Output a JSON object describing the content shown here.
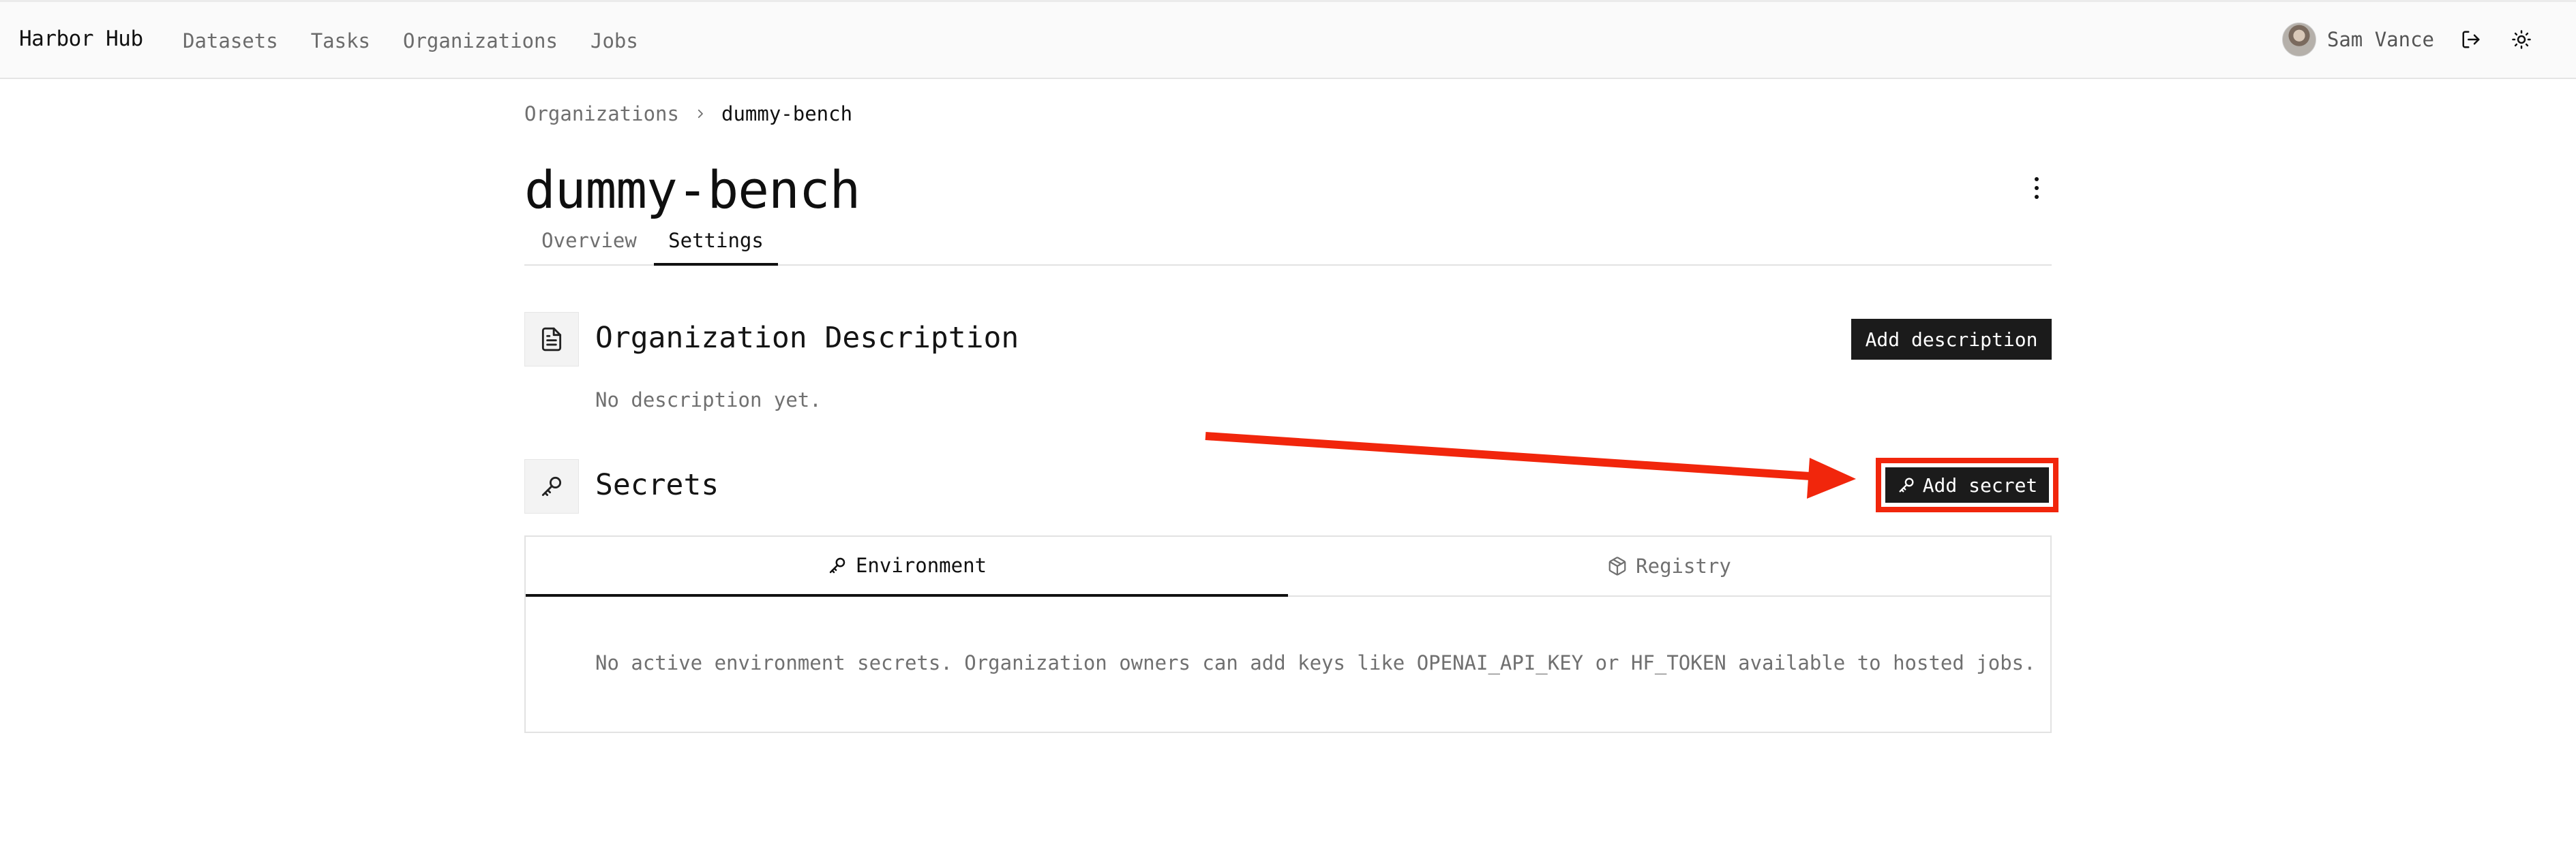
{
  "app": {
    "brand": "Harbor Hub",
    "nav": [
      "Datasets",
      "Tasks",
      "Organizations",
      "Jobs"
    ],
    "user": {
      "name": "Sam Vance",
      "logout_icon": "logout-icon",
      "theme_icon": "sun-icon"
    }
  },
  "breadcrumb": {
    "parent": "Organizations",
    "current": "dummy-bench"
  },
  "page": {
    "title": "dummy-bench",
    "tabs": [
      {
        "label": "Overview",
        "active": false
      },
      {
        "label": "Settings",
        "active": true
      }
    ]
  },
  "description_section": {
    "title": "Organization Description",
    "icon": "document-icon",
    "button_label": "Add description",
    "empty_text": "No description yet."
  },
  "secrets_section": {
    "title": "Secrets",
    "icon": "key-icon",
    "button_label": "Add secret",
    "tabs": [
      {
        "label": "Environment",
        "icon": "key-icon",
        "active": true
      },
      {
        "label": "Registry",
        "icon": "package-icon",
        "active": false
      }
    ],
    "empty_text": "No active environment secrets. Organization owners can add keys like OPENAI_API_KEY or HF_TOKEN available to hosted jobs."
  },
  "annotation": {
    "highlight_color": "#f1260c",
    "target": "Add secret"
  },
  "colors": {
    "button_bg": "#1b1b1b",
    "active_tab_underline": "#111111"
  }
}
